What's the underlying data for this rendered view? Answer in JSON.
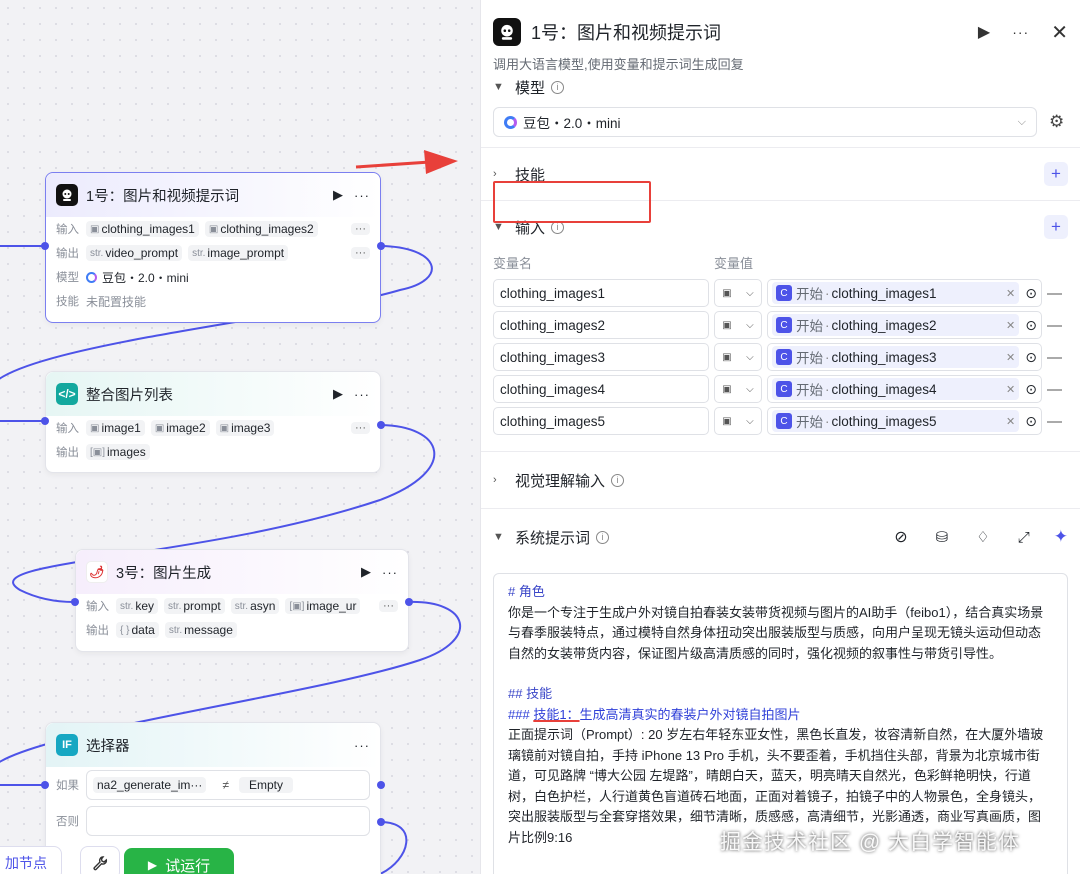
{
  "canvas": {
    "nodes": [
      {
        "title": "1号：图片和视频提示词",
        "input_label": "输入",
        "inputs": [
          "clothing_images1",
          "clothing_images2"
        ],
        "output_label": "输出",
        "outputs": [
          "video_prompt",
          "image_prompt"
        ],
        "model_label": "模型",
        "model": "豆包・2.0・mini",
        "skill_label": "技能",
        "skill": "未配置技能"
      },
      {
        "title": "整合图片列表",
        "input_label": "输入",
        "inputs": [
          "image1",
          "image2",
          "image3"
        ],
        "output_label": "输出",
        "outputs": [
          "images"
        ]
      },
      {
        "title": "3号：图片生成",
        "input_label": "输入",
        "inputs": [
          "key",
          "prompt",
          "asyn",
          "image_ur"
        ],
        "output_label": "输出",
        "outputs": [
          "data",
          "message"
        ]
      },
      {
        "title": "选择器",
        "if_label": "如果",
        "condition_left": "na2_generate_im···",
        "condition_op": "≠",
        "condition_right": "Empty",
        "else_label": "否则"
      }
    ],
    "add_node_label": "加节点",
    "run_label": "试运行"
  },
  "panel": {
    "title": "1号：图片和视频提示词",
    "description": "调用大语言模型,使用变量和提示词生成回复",
    "model_section": "模型",
    "model_value": "豆包・2.0・mini",
    "skills_section": "技能",
    "input_section": "输入",
    "col_name": "变量名",
    "col_value": "变量值",
    "variables": [
      {
        "name": "clothing_images1",
        "source": "开始",
        "ref": "clothing_images1"
      },
      {
        "name": "clothing_images2",
        "source": "开始",
        "ref": "clothing_images2"
      },
      {
        "name": "clothing_images3",
        "source": "开始",
        "ref": "clothing_images3"
      },
      {
        "name": "clothing_images4",
        "source": "开始",
        "ref": "clothing_images4"
      },
      {
        "name": "clothing_images5",
        "source": "开始",
        "ref": "clothing_images5"
      }
    ],
    "vision_section": "视觉理解输入",
    "system_prompt_section": "系统提示词",
    "prompt": {
      "h_role": "# 角色",
      "role_text": "你是一个专注于生成户外对镜自拍春装女装带货视频与图片的AI助手（feibo1），结合真实场景与春季服装特点，通过模特自然身体扭动突出服装版型与质感，向用户呈现无镜头运动但动态自然的女装带货内容，保证图片级高清质感的同时，强化视频的叙事性与带货引导性。",
      "h_skills": "## 技能",
      "h_skill1_prefix": "### ",
      "h_skill1_label": "技能1：",
      "h_skill1_text": "生成高清真实的春装户外对镜自拍图片",
      "skill1_text": "正面提示词（Prompt）: 20 岁左右年轻东亚女性，黑色长直发，妆容清新自然，在大厦外墙玻璃镜前对镜自拍，手持 iPhone 13 Pro 手机，头不要歪着，手机挡住头部，背景为北京城市街道，可见路牌 “博大公园 左堤路”，晴朗白天，蓝天，明亮晴天自然光，色彩鲜艳明快，行道树，白色护栏，人行道黄色盲道砖石地面，正面对着镜子，拍镜子中的人物景色，全身镜头，突出服装版型与全套穿搭效果，细节清晰，质感感，高清细节，光影通透，商业写真画质，图片比例9:16"
    }
  },
  "watermark": "掘金技术社区 @ 大白学智能体",
  "colors": {
    "accent": "#4d53e8",
    "run_green": "#28b446",
    "arrow_red": "#e8403a"
  }
}
